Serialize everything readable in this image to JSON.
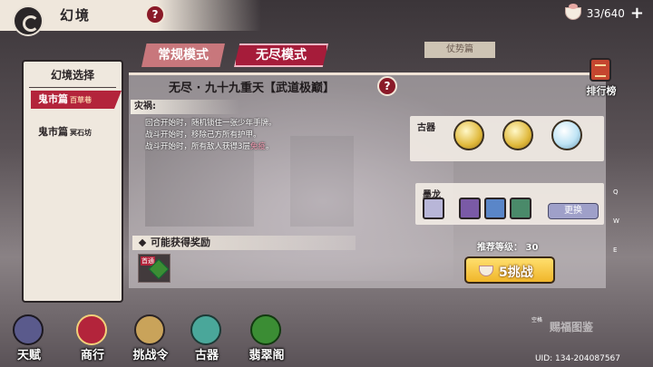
{
  "top": {
    "title": "幻境",
    "help": "?",
    "stamina": "33/640",
    "add": "+"
  },
  "tabs": {
    "normal": "常规模式",
    "endless": "无尽模式",
    "behind": "仗势篇"
  },
  "left_panel": {
    "header": "幻境选择",
    "stages": [
      {
        "name": "鬼市篇",
        "sub": "百草巷"
      },
      {
        "name": "鬼市篇",
        "sub": "冥石坊"
      }
    ]
  },
  "stage": {
    "title": "无尽 · 九十九重天【武道极巅】",
    "help": "?",
    "rank_label": "排行榜",
    "curse_label": "灾祸:",
    "curse_lines": [
      "回合开始时，随机锁住一张少年手牌。",
      "战斗开始时，移除己方所有护甲。"
    ],
    "curse_line3_a": "战斗开始时，所有敌人获得3层",
    "curse_line3_b": "免疫",
    "curse_line3_c": "。"
  },
  "artifacts": {
    "label": "古器"
  },
  "heroes": {
    "label": "墨龙",
    "change": "更换"
  },
  "recommend": "推荐等级：  30",
  "challenge": "5挑战",
  "rewards": {
    "label": "可能获得奖励",
    "first_tag": "首通"
  },
  "side_letters": [
    "Q",
    "W",
    "E"
  ],
  "nav": [
    {
      "label": "天赋",
      "color": "#5a5a8c"
    },
    {
      "label": "商行",
      "color": "#b3243b"
    },
    {
      "label": "挑战令",
      "color": "#c9a35a"
    },
    {
      "label": "古器",
      "color": "#4aa79a"
    },
    {
      "label": "翡翠阁",
      "color": "#3b8d34"
    }
  ],
  "gallery": "赐福图鉴",
  "small_label": "空格",
  "uid": "UID: 134-204087567"
}
